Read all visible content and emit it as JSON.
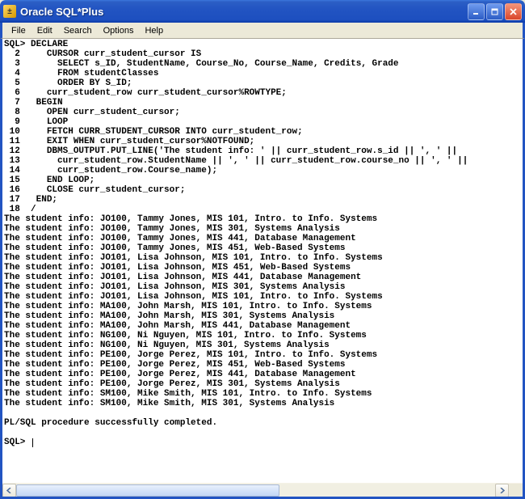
{
  "window": {
    "title": "Oracle SQL*Plus"
  },
  "menu": {
    "file": "File",
    "edit": "Edit",
    "search": "Search",
    "options": "Options",
    "help": "Help"
  },
  "terminal": {
    "prompt": "SQL>",
    "code": {
      "l1": "DECLARE",
      "l2": "CURSOR curr_student_cursor IS",
      "l3": "SELECT s_ID, StudentName, Course_No, Course_Name, Credits, Grade",
      "l4": "FROM studentClasses",
      "l5": "ORDER BY S_ID;",
      "l6": "curr_student_row curr_student_cursor%ROWTYPE;",
      "l7": "BEGIN",
      "l8": "OPEN curr_student_cursor;",
      "l9": "LOOP",
      "l10": "FETCH CURR_STUDENT_CURSOR INTO curr_student_row;",
      "l11": "EXIT WHEN curr_student_cursor%NOTFOUND;",
      "l12": "DBMS_OUTPUT.PUT_LINE('The student info: ' || curr_student_row.s_id || ', ' ||",
      "l13": "curr_student_row.StudentName || ', ' || curr_student_row.course_no || ', ' ||",
      "l14": "curr_student_row.Course_name);",
      "l15": "END LOOP;",
      "l16": "CLOSE curr_student_cursor;",
      "l17": "END;",
      "l18": "/"
    },
    "linenums": {
      "n2": "2",
      "n3": "3",
      "n4": "4",
      "n5": "5",
      "n6": "6",
      "n7": "7",
      "n8": "8",
      "n9": "9",
      "n10": "10",
      "n11": "11",
      "n12": "12",
      "n13": "13",
      "n14": "14",
      "n15": "15",
      "n16": "16",
      "n17": "17",
      "n18": "18"
    },
    "output": {
      "r1": "The student info: JO100, Tammy Jones, MIS 101, Intro. to Info. Systems",
      "r2": "The student info: JO100, Tammy Jones, MIS 301, Systems Analysis",
      "r3": "The student info: JO100, Tammy Jones, MIS 441, Database Management",
      "r4": "The student info: JO100, Tammy Jones, MIS 451, Web-Based Systems",
      "r5": "The student info: JO101, Lisa Johnson, MIS 101, Intro. to Info. Systems",
      "r6": "The student info: JO101, Lisa Johnson, MIS 451, Web-Based Systems",
      "r7": "The student info: JO101, Lisa Johnson, MIS 441, Database Management",
      "r8": "The student info: JO101, Lisa Johnson, MIS 301, Systems Analysis",
      "r9": "The student info: JO101, Lisa Johnson, MIS 101, Intro. to Info. Systems",
      "r10": "The student info: MA100, John Marsh, MIS 101, Intro. to Info. Systems",
      "r11": "The student info: MA100, John Marsh, MIS 301, Systems Analysis",
      "r12": "The student info: MA100, John Marsh, MIS 441, Database Management",
      "r13": "The student info: NG100, Ni Nguyen, MIS 101, Intro. to Info. Systems",
      "r14": "The student info: NG100, Ni Nguyen, MIS 301, Systems Analysis",
      "r15": "The student info: PE100, Jorge Perez, MIS 101, Intro. to Info. Systems",
      "r16": "The student info: PE100, Jorge Perez, MIS 451, Web-Based Systems",
      "r17": "The student info: PE100, Jorge Perez, MIS 441, Database Management",
      "r18": "The student info: PE100, Jorge Perez, MIS 301, Systems Analysis",
      "r19": "The student info: SM100, Mike Smith, MIS 101, Intro. to Info. Systems",
      "r20": "The student info: SM100, Mike Smith, MIS 301, Systems Analysis"
    },
    "status": "PL/SQL procedure successfully completed.",
    "prompt2": "SQL> "
  }
}
